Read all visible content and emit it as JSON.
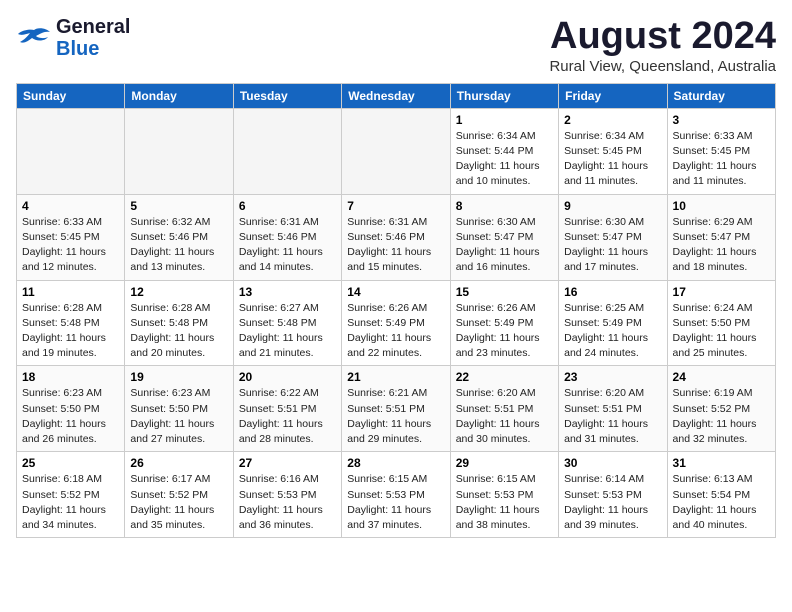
{
  "header": {
    "logo_line1": "General",
    "logo_line2": "Blue",
    "title": "August 2024",
    "subtitle": "Rural View, Queensland, Australia"
  },
  "calendar": {
    "days_of_week": [
      "Sunday",
      "Monday",
      "Tuesday",
      "Wednesday",
      "Thursday",
      "Friday",
      "Saturday"
    ],
    "weeks": [
      [
        {
          "day": "",
          "info": ""
        },
        {
          "day": "",
          "info": ""
        },
        {
          "day": "",
          "info": ""
        },
        {
          "day": "",
          "info": ""
        },
        {
          "day": "1",
          "info": "Sunrise: 6:34 AM\nSunset: 5:44 PM\nDaylight: 11 hours\nand 10 minutes."
        },
        {
          "day": "2",
          "info": "Sunrise: 6:34 AM\nSunset: 5:45 PM\nDaylight: 11 hours\nand 11 minutes."
        },
        {
          "day": "3",
          "info": "Sunrise: 6:33 AM\nSunset: 5:45 PM\nDaylight: 11 hours\nand 11 minutes."
        }
      ],
      [
        {
          "day": "4",
          "info": "Sunrise: 6:33 AM\nSunset: 5:45 PM\nDaylight: 11 hours\nand 12 minutes."
        },
        {
          "day": "5",
          "info": "Sunrise: 6:32 AM\nSunset: 5:46 PM\nDaylight: 11 hours\nand 13 minutes."
        },
        {
          "day": "6",
          "info": "Sunrise: 6:31 AM\nSunset: 5:46 PM\nDaylight: 11 hours\nand 14 minutes."
        },
        {
          "day": "7",
          "info": "Sunrise: 6:31 AM\nSunset: 5:46 PM\nDaylight: 11 hours\nand 15 minutes."
        },
        {
          "day": "8",
          "info": "Sunrise: 6:30 AM\nSunset: 5:47 PM\nDaylight: 11 hours\nand 16 minutes."
        },
        {
          "day": "9",
          "info": "Sunrise: 6:30 AM\nSunset: 5:47 PM\nDaylight: 11 hours\nand 17 minutes."
        },
        {
          "day": "10",
          "info": "Sunrise: 6:29 AM\nSunset: 5:47 PM\nDaylight: 11 hours\nand 18 minutes."
        }
      ],
      [
        {
          "day": "11",
          "info": "Sunrise: 6:28 AM\nSunset: 5:48 PM\nDaylight: 11 hours\nand 19 minutes."
        },
        {
          "day": "12",
          "info": "Sunrise: 6:28 AM\nSunset: 5:48 PM\nDaylight: 11 hours\nand 20 minutes."
        },
        {
          "day": "13",
          "info": "Sunrise: 6:27 AM\nSunset: 5:48 PM\nDaylight: 11 hours\nand 21 minutes."
        },
        {
          "day": "14",
          "info": "Sunrise: 6:26 AM\nSunset: 5:49 PM\nDaylight: 11 hours\nand 22 minutes."
        },
        {
          "day": "15",
          "info": "Sunrise: 6:26 AM\nSunset: 5:49 PM\nDaylight: 11 hours\nand 23 minutes."
        },
        {
          "day": "16",
          "info": "Sunrise: 6:25 AM\nSunset: 5:49 PM\nDaylight: 11 hours\nand 24 minutes."
        },
        {
          "day": "17",
          "info": "Sunrise: 6:24 AM\nSunset: 5:50 PM\nDaylight: 11 hours\nand 25 minutes."
        }
      ],
      [
        {
          "day": "18",
          "info": "Sunrise: 6:23 AM\nSunset: 5:50 PM\nDaylight: 11 hours\nand 26 minutes."
        },
        {
          "day": "19",
          "info": "Sunrise: 6:23 AM\nSunset: 5:50 PM\nDaylight: 11 hours\nand 27 minutes."
        },
        {
          "day": "20",
          "info": "Sunrise: 6:22 AM\nSunset: 5:51 PM\nDaylight: 11 hours\nand 28 minutes."
        },
        {
          "day": "21",
          "info": "Sunrise: 6:21 AM\nSunset: 5:51 PM\nDaylight: 11 hours\nand 29 minutes."
        },
        {
          "day": "22",
          "info": "Sunrise: 6:20 AM\nSunset: 5:51 PM\nDaylight: 11 hours\nand 30 minutes."
        },
        {
          "day": "23",
          "info": "Sunrise: 6:20 AM\nSunset: 5:51 PM\nDaylight: 11 hours\nand 31 minutes."
        },
        {
          "day": "24",
          "info": "Sunrise: 6:19 AM\nSunset: 5:52 PM\nDaylight: 11 hours\nand 32 minutes."
        }
      ],
      [
        {
          "day": "25",
          "info": "Sunrise: 6:18 AM\nSunset: 5:52 PM\nDaylight: 11 hours\nand 34 minutes."
        },
        {
          "day": "26",
          "info": "Sunrise: 6:17 AM\nSunset: 5:52 PM\nDaylight: 11 hours\nand 35 minutes."
        },
        {
          "day": "27",
          "info": "Sunrise: 6:16 AM\nSunset: 5:53 PM\nDaylight: 11 hours\nand 36 minutes."
        },
        {
          "day": "28",
          "info": "Sunrise: 6:15 AM\nSunset: 5:53 PM\nDaylight: 11 hours\nand 37 minutes."
        },
        {
          "day": "29",
          "info": "Sunrise: 6:15 AM\nSunset: 5:53 PM\nDaylight: 11 hours\nand 38 minutes."
        },
        {
          "day": "30",
          "info": "Sunrise: 6:14 AM\nSunset: 5:53 PM\nDaylight: 11 hours\nand 39 minutes."
        },
        {
          "day": "31",
          "info": "Sunrise: 6:13 AM\nSunset: 5:54 PM\nDaylight: 11 hours\nand 40 minutes."
        }
      ]
    ]
  }
}
